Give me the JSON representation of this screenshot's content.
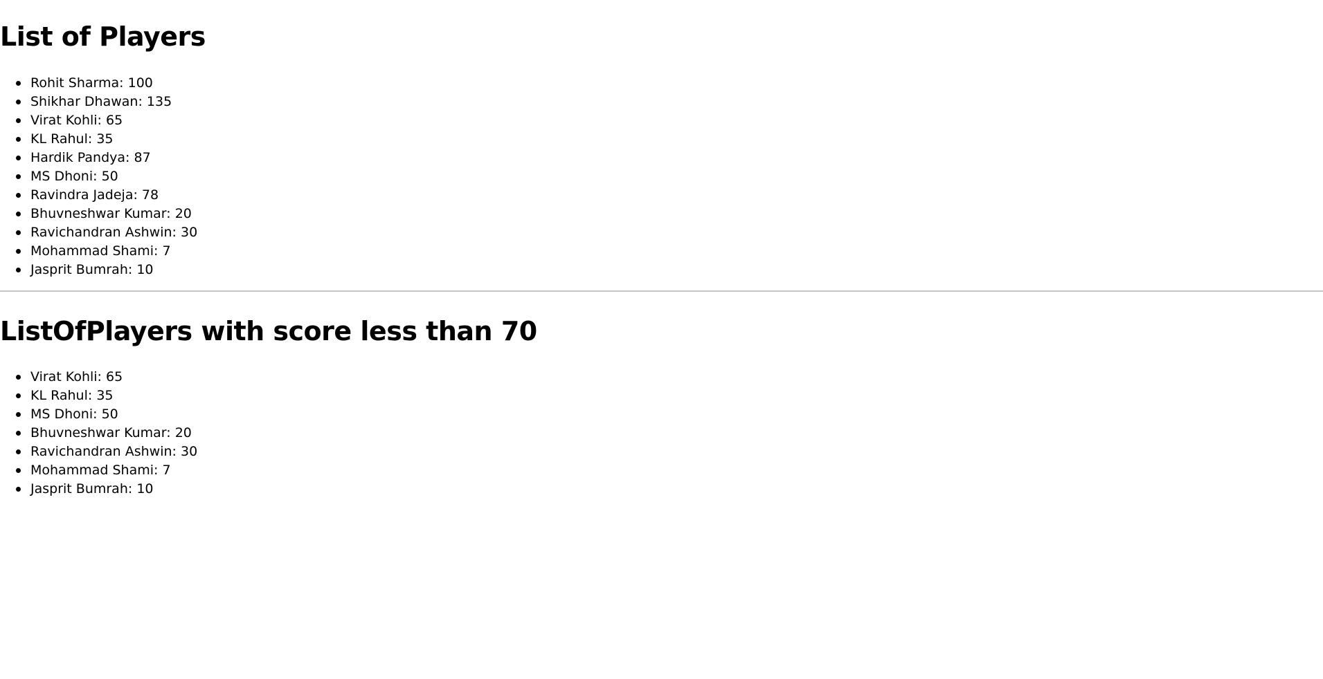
{
  "all_players": {
    "title": "List of Players",
    "items": [
      {
        "name": "Rohit Sharma",
        "score": "100"
      },
      {
        "name": "Shikhar Dhawan",
        "score": "135"
      },
      {
        "name": "Virat Kohli",
        "score": "65"
      },
      {
        "name": "KL Rahul",
        "score": "35"
      },
      {
        "name": "Hardik Pandya",
        "score": "87"
      },
      {
        "name": "MS Dhoni",
        "score": "50"
      },
      {
        "name": "Ravindra Jadeja",
        "score": "78"
      },
      {
        "name": "Bhuvneshwar Kumar",
        "score": "20"
      },
      {
        "name": "Ravichandran Ashwin",
        "score": "30"
      },
      {
        "name": "Mohammad Shami",
        "score": "7"
      },
      {
        "name": "Jasprit Bumrah",
        "score": "10"
      }
    ]
  },
  "filtered_players": {
    "title": "ListOfPlayers with score less than 70",
    "items": [
      {
        "name": "Virat Kohli",
        "score": "65"
      },
      {
        "name": "KL Rahul",
        "score": "35"
      },
      {
        "name": "MS Dhoni",
        "score": "50"
      },
      {
        "name": "Bhuvneshwar Kumar",
        "score": "20"
      },
      {
        "name": "Ravichandran Ashwin",
        "score": "30"
      },
      {
        "name": "Mohammad Shami",
        "score": "7"
      },
      {
        "name": "Jasprit Bumrah",
        "score": "10"
      }
    ]
  }
}
